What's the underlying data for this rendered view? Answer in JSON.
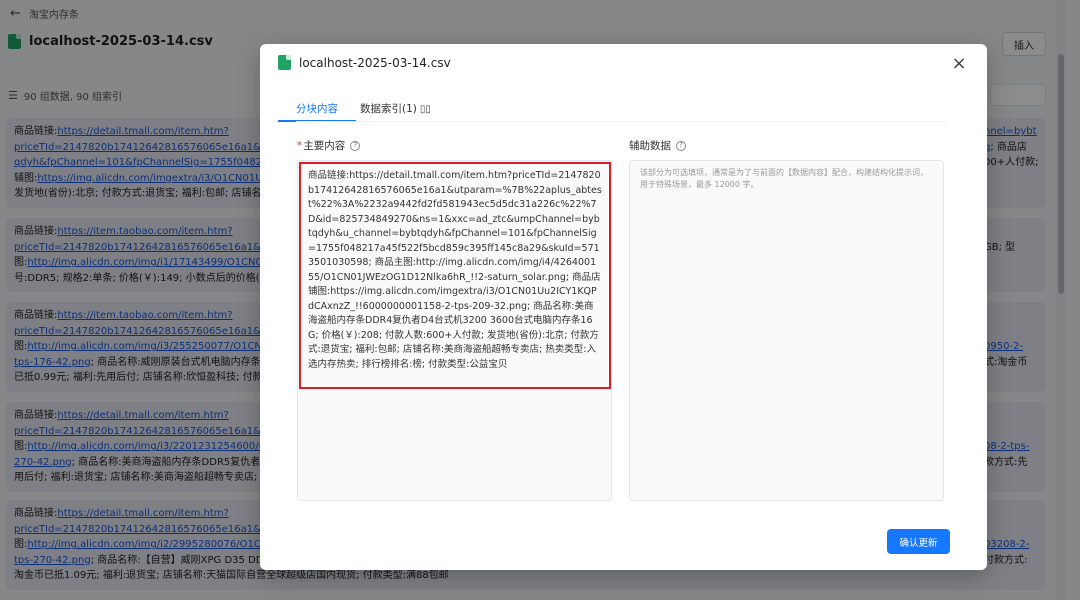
{
  "topbar": {
    "title": "淘宝内存条"
  },
  "file": {
    "name": "localhost-2025-03-14.csv"
  },
  "toolbar": {
    "insert_label": "插入"
  },
  "stats": {
    "text": "90 组数据, 90 组索引"
  },
  "cards": [
    {
      "lines": [
        [
          {
            "t": "商品链接:"
          },
          {
            "t": "https://detail.tmall.com/item.htm?",
            "l": true
          }
        ],
        [
          {
            "t": "priceTId=2147820b17412642816576065e16a1&utpar",
            "l": true
          }
        ],
        [
          {
            "t": "qdyh&fpChannel=101&fpChannelSig=1755f048217a4",
            "l": true
          }
        ],
        [
          {
            "t": "辅图:"
          },
          {
            "t": "https://img.alicdn.com/imgextra/i3/O1CN01Uu2",
            "l": true
          }
        ],
        [
          {
            "t": "发货地(省份):北京; 付款方式:退货宝; 福利:包邮; 店铺名称"
          }
        ]
      ],
      "right": [
        [
          {
            "t": "nnel=bybt",
            "l": true
          }
        ],
        [
          {
            "t": "q",
            "l": true
          },
          {
            "t": "; 商品店"
          }
        ],
        [
          {
            "t": "00+人付款;"
          }
        ]
      ]
    },
    {
      "lines": [
        [
          {
            "t": "商品链接:"
          },
          {
            "t": "https://item.taobao.com/item.htm?",
            "l": true
          }
        ],
        [
          {
            "t": "priceTId=2147820b17412642816576065e16a1&utpar",
            "l": true
          }
        ],
        [
          {
            "t": "图:"
          },
          {
            "t": "http://img.alicdn.com/img/i1/17143499/O1CN01a",
            "l": true
          }
        ],
        [
          {
            "t": "号:DDR5; 规格2:单条; 价格(￥):149; 小数点后的价格(￥):"
          }
        ]
      ],
      "right": [
        [
          {
            "t": ""
          }
        ],
        [
          {
            "t": "GB; 型"
          }
        ]
      ]
    },
    {
      "lines": [
        [
          {
            "t": "商品链接:"
          },
          {
            "t": "https://item.taobao.com/item.htm?",
            "l": true
          }
        ],
        [
          {
            "t": "priceTId=2147820b17412642816576065e16a1&utpar",
            "l": true
          }
        ],
        [
          {
            "t": "图:"
          },
          {
            "t": "http://img.alicdn.com/img/i3/255250077/O1CN01",
            "l": true
          }
        ],
        [
          {
            "t": "tps-176-42.png",
            "l": true
          },
          {
            "t": "; 商品名称:威刚原装台式机电脑内存条DD"
          }
        ],
        [
          {
            "t": "已抵0.99元; 福利:先用后付; 店铺名称:欣恒盈科技; 付款类"
          }
        ]
      ],
      "right": [
        [
          {
            "t": ""
          }
        ],
        [
          {
            "t": ""
          }
        ],
        [
          {
            "t": "0950-2-",
            "l": true
          }
        ],
        [
          {
            "t": "式:淘金币"
          }
        ]
      ]
    },
    {
      "lines": [
        [
          {
            "t": "商品链接:"
          },
          {
            "t": "https://detail.tmall.com/item.htm?",
            "l": true
          }
        ],
        [
          {
            "t": "priceTId=2147820b17412642816576065e16a1&utpar",
            "l": true
          }
        ],
        [
          {
            "t": "图:"
          },
          {
            "t": "http://img.alicdn.com/img/i3/2201231254600/O1C",
            "l": true
          }
        ],
        [
          {
            "t": "270-42.png",
            "l": true
          },
          {
            "t": "; 商品名称:美商海盗船内存条DDR5复仇者台"
          }
        ],
        [
          {
            "t": "用后付; 福利:退货宝; 店铺名称:美商海盗船超畅专卖店;"
          }
        ]
      ],
      "right": [
        [
          {
            "t": ""
          }
        ],
        [
          {
            "t": ""
          }
        ],
        [
          {
            "t": "08-2-tps-",
            "l": true
          }
        ],
        [
          {
            "t": "款方式:先"
          }
        ]
      ]
    },
    {
      "lines": [
        [
          {
            "t": "商品链接:"
          },
          {
            "t": "https://detail.tmall.com/item.htm?",
            "l": true
          }
        ],
        [
          {
            "t": "priceTId=2147820b17412642816576065e16a1&utpar",
            "l": true
          }
        ],
        [
          {
            "t": "图:"
          },
          {
            "t": "http://img.alicdn.com/img/i2/2995280076/O1CN01",
            "l": true
          }
        ],
        [
          {
            "t": "tps-270-42.png",
            "l": true
          },
          {
            "t": "; 商品名称:【自营】威刚XPG D35 DDR4"
          }
        ],
        [
          {
            "t": "淘金币已抵1.09元; 福利:退货宝; 店铺名称:天猫国际自营全球超级店国内现货; 付款类型:满88包邮"
          }
        ]
      ],
      "right": [
        [
          {
            "t": ""
          }
        ],
        [
          {
            "t": ""
          }
        ],
        [
          {
            "t": "03208-2-",
            "l": true
          }
        ],
        [
          {
            "t": "付款方式:"
          }
        ]
      ]
    }
  ],
  "modal": {
    "title": "localhost-2025-03-14.csv",
    "close_label": "×",
    "tabs": [
      {
        "label": "分块内容",
        "active": true
      },
      {
        "label": "数据索引(1)",
        "active": false
      }
    ],
    "main_label": "主要内容",
    "required_mark": "*",
    "aux_label": "辅助数据",
    "help_glyph": "?",
    "main_content": "商品链接:https://detail.tmall.com/item.htm?priceTId=2147820b17412642816576065e16a1&utparam=%7B%22aplus_abtest%22%3A%2232a9442fd2fd581943ec5d5dc31a226c%22%7D&id=825734849270&ns=1&xxc=ad_ztc&umpChannel=bybtqdyh&u_channel=bybtqdyh&fpChannel=101&fpChannelSig=1755f048217a45f522f5bcd859c395ff145c8a29&skuId=5713501030598; 商品主图:http://img.alicdn.com/img/i4/426400155/O1CN01JWEzOG1D12Nlka6hR_!!2-saturn_solar.png; 商品店铺图:https://img.alicdn.com/imgextra/i3/O1CN01Uu2ICY1KQPdCAxnzZ_!!6000000001158-2-tps-209-32.png; 商品名称:美商海盗船内存条DDR4复仇者D4台式机3200 3600台式电脑内存条16G; 价格(￥):208; 付款人数:600+人付款; 发货地(省份):北京; 付款方式:退货宝; 福利:包邮; 店铺名称:美商海盗船超畅专卖店; 热卖类型:入选内存热卖; 排行榜排名:榜; 付款类型:公益宝贝",
    "aux_placeholder": "该部分为可选填项，通常是为了与前面的【数据内容】配合，构建结构化提示词，用于特殊场景，最多 12000 字。",
    "confirm_label": "确认更新"
  }
}
